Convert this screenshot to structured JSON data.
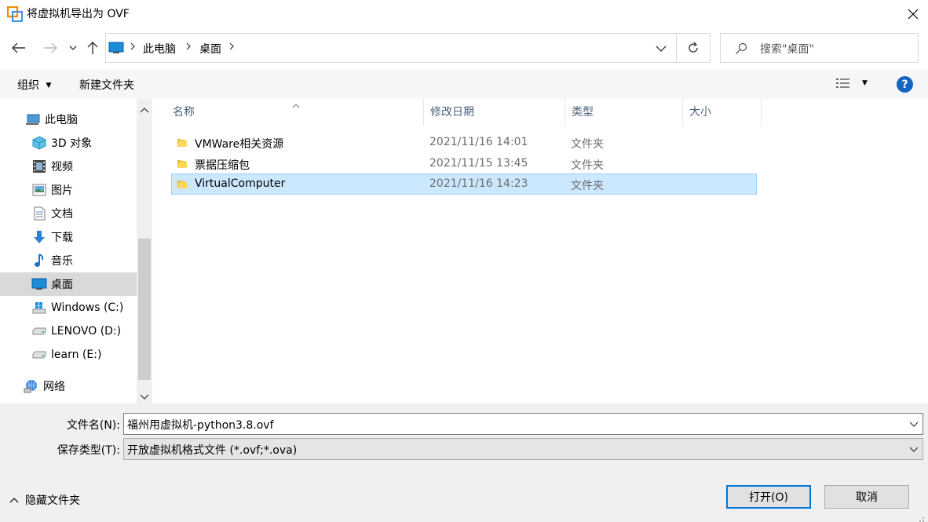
{
  "window": {
    "title": "将虚拟机导出为 OVF"
  },
  "breadcrumb": {
    "items": [
      "此电脑",
      "桌面"
    ]
  },
  "search": {
    "placeholder": "搜索\"桌面\""
  },
  "toolbar": {
    "organize_label": "组织",
    "new_folder_label": "新建文件夹"
  },
  "sidebar": {
    "items": [
      {
        "label": "此电脑",
        "icon": "computer-icon"
      },
      {
        "label": "3D 对象",
        "icon": "3d-objects-icon"
      },
      {
        "label": "视频",
        "icon": "video-icon"
      },
      {
        "label": "图片",
        "icon": "pictures-icon"
      },
      {
        "label": "文档",
        "icon": "documents-icon"
      },
      {
        "label": "下载",
        "icon": "download-icon"
      },
      {
        "label": "音乐",
        "icon": "music-icon"
      },
      {
        "label": "桌面",
        "icon": "desktop-icon",
        "selected": true
      },
      {
        "label": "Windows (C:)",
        "icon": "windows-drive-icon"
      },
      {
        "label": "LENOVO (D:)",
        "icon": "drive-icon"
      },
      {
        "label": "learn (E:)",
        "icon": "drive-icon"
      },
      {
        "label": "网络",
        "icon": "network-icon"
      }
    ]
  },
  "filelist": {
    "columns": [
      "名称",
      "修改日期",
      "类型",
      "大小"
    ],
    "rows": [
      {
        "name": "VMWare相关资源",
        "date": "2021/11/16 14:01",
        "type": "文件夹",
        "selected": false
      },
      {
        "name": "票据压缩包",
        "date": "2021/11/15 13:45",
        "type": "文件夹",
        "selected": false
      },
      {
        "name": "VirtualComputer",
        "date": "2021/11/16 14:23",
        "type": "文件夹",
        "selected": true
      }
    ]
  },
  "bottom": {
    "filename_label": "文件名(N):",
    "filename_value": "福州用虚拟机-python3.8.ovf",
    "filetype_label": "保存类型(T):",
    "filetype_value": "开放虚拟机格式文件 (*.ovf;*.ova)",
    "hide_folders_label": "隐藏文件夹",
    "open_label": "打开(O)",
    "cancel_label": "取消"
  },
  "colors": {
    "selection_bg": "#cce8ff",
    "selection_border": "#99d1ff",
    "accent": "#0078d7",
    "help_blue": "#1565c0"
  }
}
